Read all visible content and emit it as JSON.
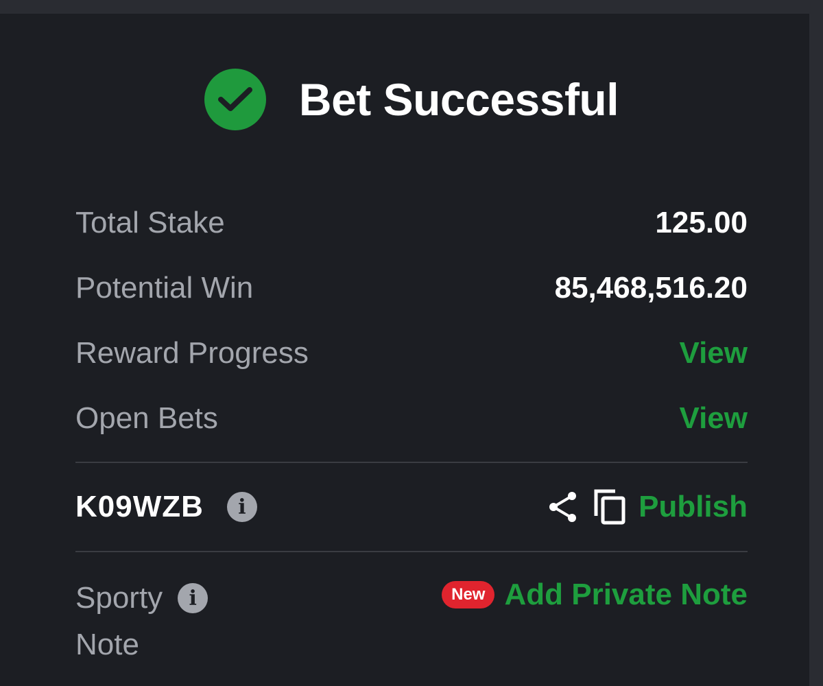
{
  "header": {
    "title": "Bet Successful",
    "icon": "check-circle-icon",
    "accent_color": "#1f9a3d"
  },
  "summary": {
    "total_stake_label": "Total Stake",
    "total_stake_value": "125.00",
    "potential_win_label": "Potential Win",
    "potential_win_value": "85,468,516.20",
    "reward_progress_label": "Reward Progress",
    "reward_progress_link": "View",
    "open_bets_label": "Open Bets",
    "open_bets_link": "View"
  },
  "booking": {
    "code": "K09WZB",
    "info_icon": "info-icon",
    "share_icon": "share-icon",
    "copy_icon": "copy-icon",
    "publish_label": "Publish"
  },
  "note": {
    "label_line1": "Sporty",
    "label_line2": "Note",
    "info_icon": "info-icon",
    "badge_label": "New",
    "add_note_label": "Add Private Note"
  },
  "colors": {
    "background": "#1c1e23",
    "link_green": "#1e9e3e",
    "badge_red": "#e0242e",
    "muted_text": "#a3a6ad"
  }
}
